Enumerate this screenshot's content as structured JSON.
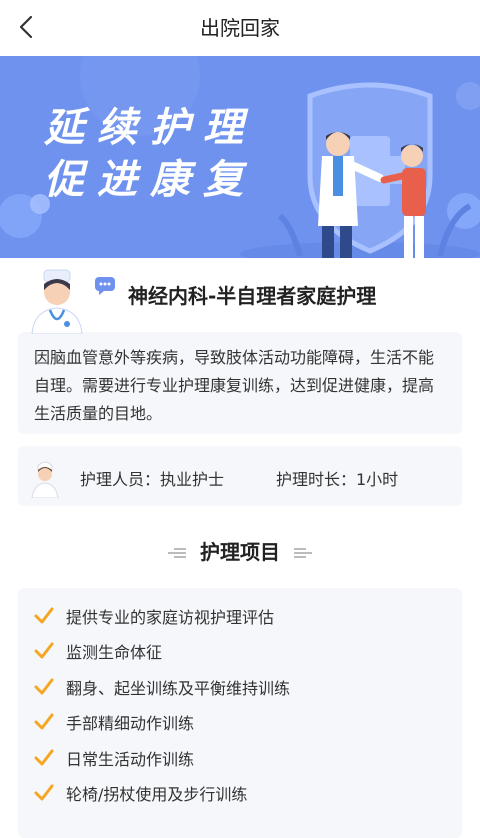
{
  "header": {
    "title": "出院回家"
  },
  "banner": {
    "line1": "延续护理",
    "line2": "促进康复"
  },
  "service": {
    "title": "神经内科-半自理者家庭护理",
    "description": "因脑血管意外等疾病，导致肢体活动功能障碍，生活不能自理。需要进行专业护理康复训练，达到促进健康，提高生活质量的目地。"
  },
  "info": {
    "staff": "护理人员：执业护士",
    "duration": "护理时长：1小时"
  },
  "care_section": {
    "title": "护理项目",
    "items": [
      "提供专业的家庭访视护理评估",
      "监测生命体征",
      "翻身、起坐训练及平衡维持训练",
      "手部精细动作训练",
      "日常生活动作训练",
      "轮椅/拐杖使用及步行训练"
    ]
  },
  "colors": {
    "banner_bg": "#6f92ee",
    "accent": "#f5a623",
    "panel": "#f5f7fb"
  }
}
